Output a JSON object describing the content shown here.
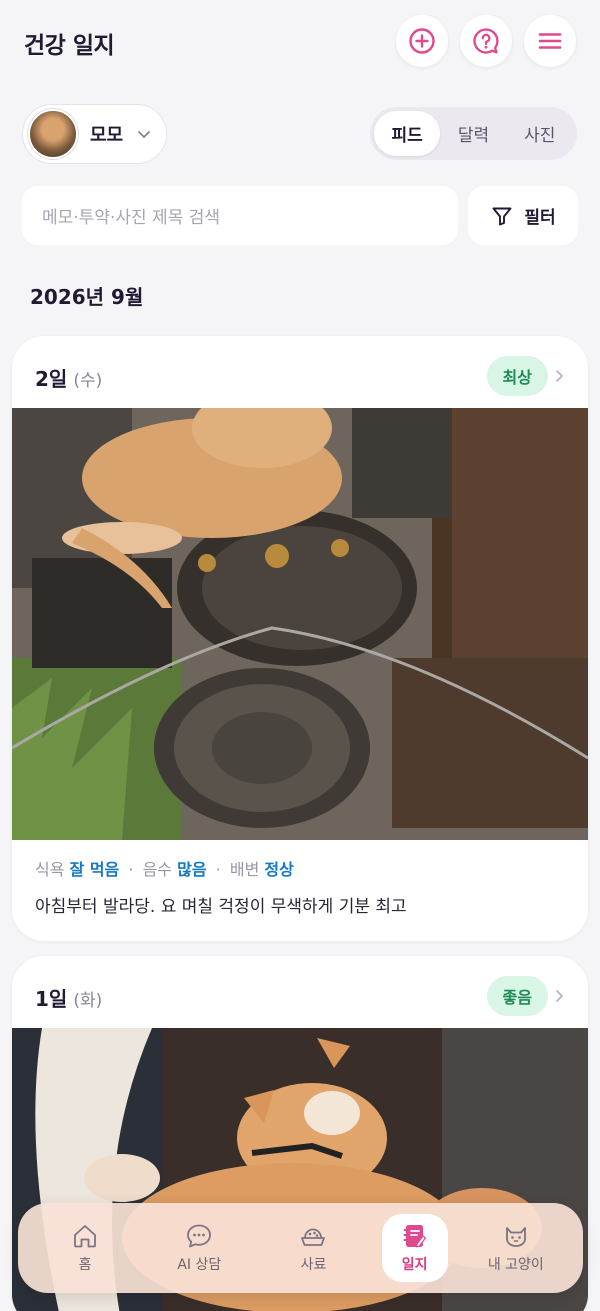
{
  "header": {
    "title": "건강 일지",
    "add_icon": "plus-circle-icon",
    "help_icon": "question-icon",
    "menu_icon": "hamburger-menu-icon",
    "accent_color": "#e0488f"
  },
  "cat_selector": {
    "name": "모모"
  },
  "view_toggle": {
    "tabs": [
      "피드",
      "달력",
      "사진"
    ],
    "active": "피드"
  },
  "search": {
    "placeholder": "메모·투약·사진 제목 검색"
  },
  "filter": {
    "label": "필터"
  },
  "month": "2026년 9월",
  "entries": [
    {
      "date": "2일",
      "dow": "(수)",
      "mood": "최상",
      "meta": {
        "food_label": "식욕",
        "food_value": "잘 먹음",
        "water_label": "음수",
        "water_value": "많음",
        "stool_label": "배변",
        "stool_value": "정상"
      },
      "memo": "아침부터 발라당. 요 며칠 걱정이 무색하게 기분 최고"
    },
    {
      "date": "1일",
      "dow": "(화)",
      "mood": "좋음"
    }
  ],
  "bottom_nav": {
    "items": [
      {
        "label": "홈",
        "icon": "home-icon"
      },
      {
        "label": "AI 상담",
        "icon": "chat-bubble-icon"
      },
      {
        "label": "사료",
        "icon": "food-bowl-icon"
      },
      {
        "label": "일지",
        "icon": "journal-icon"
      },
      {
        "label": "내 고양이",
        "icon": "cat-face-icon"
      }
    ],
    "active": "일지"
  }
}
